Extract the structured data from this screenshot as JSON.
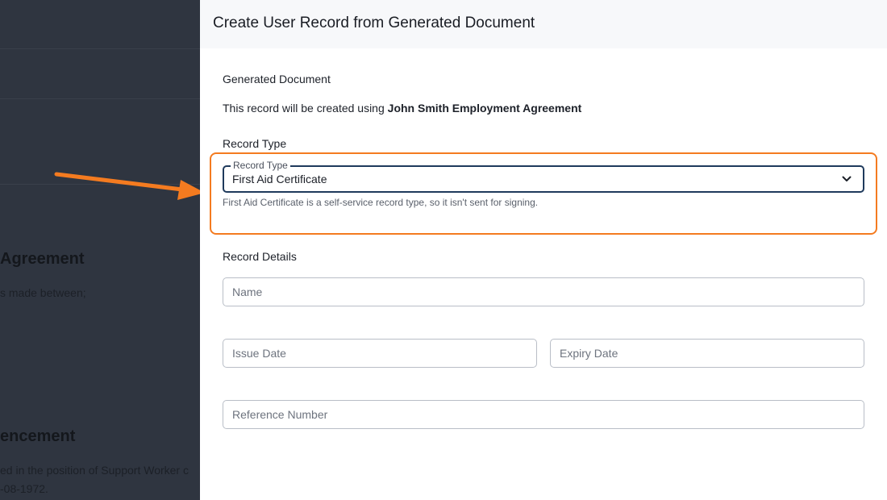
{
  "background_doc": {
    "heading1": "Agreement",
    "text1": "s made between;",
    "heading2": "encement",
    "text2": "ed in the position of Support Worker c",
    "text3": "-08-1972."
  },
  "drawer": {
    "title": "Create User Record from Generated Document",
    "generated_document": {
      "label": "Generated Document",
      "sentence_prefix": "This record will be created using ",
      "document_name": "John Smith Employment Agreement"
    },
    "record_type": {
      "section_label": "Record Type",
      "field_label": "Record Type",
      "selected_value": "First Aid Certificate",
      "helper_text": "First Aid Certificate is a self-service record type, so it isn't sent for signing."
    },
    "record_details": {
      "section_label": "Record Details",
      "name_placeholder": "Name",
      "issue_date_placeholder": "Issue Date",
      "expiry_date_placeholder": "Expiry Date",
      "reference_placeholder": "Reference Number"
    }
  },
  "annotation": {
    "highlight_color": "#f47b20"
  }
}
